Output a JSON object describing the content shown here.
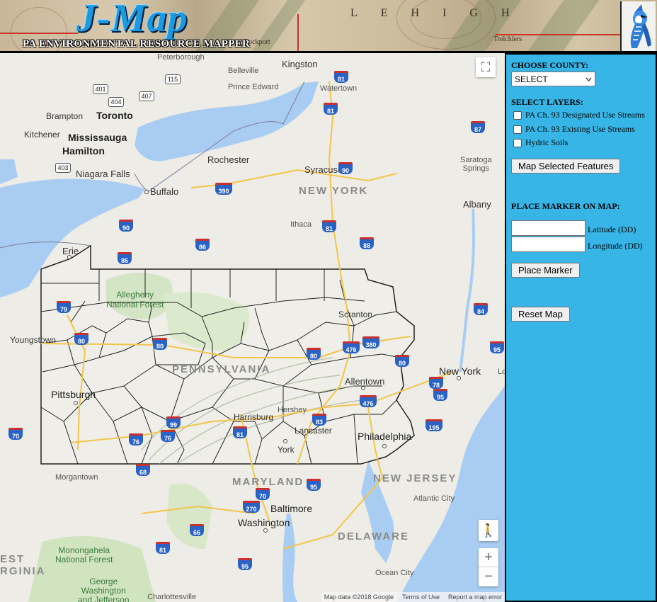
{
  "header": {
    "logo_title": "J-Map",
    "logo_subtitle": "PA ENVIRONMENTAL RESOURCE MAPPER",
    "region_label": "LEHIGH",
    "map_words": [
      "Treichlers",
      "Lockport"
    ]
  },
  "map": {
    "places": {
      "peterborough": "Peterborough",
      "belleville": "Belleville",
      "kingston": "Kingston",
      "prince_edward": "Prince Edward",
      "watertown": "Watertown",
      "brampton": "Brampton",
      "toronto": "Toronto",
      "kitchener": "Kitchener",
      "mississauga": "Mississauga",
      "hamilton": "Hamilton",
      "niagara_falls": "Niagara Falls",
      "buffalo": "Buffalo",
      "rochester": "Rochester",
      "syracuse": "Syracuse",
      "saratoga_springs": "Saratoga\nSprings",
      "albany": "Albany",
      "ithaca": "Ithaca",
      "erie": "Erie",
      "youngstown": "Youngstown",
      "scranton": "Scranton",
      "allentown": "Allentown",
      "new_york": "New York",
      "pittsburgh": "Pittsburgh",
      "hershey": "Hershey",
      "harrisburg": "Harrisburg",
      "lancaster": "Lancaster",
      "york": "York",
      "philadelphia": "Philadelphia",
      "morgantown": "Morgantown",
      "baltimore": "Baltimore",
      "washington": "Washington",
      "atlantic_city": "Atlantic City",
      "ocean_city": "Ocean City",
      "charlottesville": "Charlottesville",
      "george_washington": "George\nWashington\nand Jefferson",
      "lo": "Lo"
    },
    "states": {
      "new_york_state": "NEW YORK",
      "pennsylvania": "PENNSYLVANIA",
      "maryland": "MARYLAND",
      "new_jersey": "NEW JERSEY",
      "delaware": "DELAWARE",
      "west_virginia_a": "EST",
      "west_virginia_b": "RGINIA"
    },
    "parks": {
      "allegheny": "Allegheny\nNational Forest",
      "monongahela": "Monongahela\nNational Forest"
    },
    "highways": [
      "81",
      "81",
      "401",
      "404",
      "407",
      "115",
      "403",
      "87",
      "90",
      "390",
      "81",
      "88",
      "86",
      "86",
      "90",
      "79",
      "80",
      "80",
      "84",
      "380",
      "476",
      "80",
      "95",
      "78",
      "476",
      "95",
      "80",
      "70",
      "99",
      "76",
      "76",
      "81",
      "83",
      "195",
      "68",
      "70",
      "270",
      "95",
      "66",
      "81",
      "95"
    ],
    "controls": {
      "fullscreen_icon": "⛶",
      "pegman_icon": "🚶",
      "zoom_in": "+",
      "zoom_out": "−"
    },
    "attribution": {
      "data": "Map data ©2018 Google",
      "terms": "Terms of Use",
      "report": "Report a map error"
    }
  },
  "panel": {
    "county_heading": "CHOOSE COUNTY:",
    "county_select_value": "SELECT",
    "layers_heading": "SELECT LAYERS:",
    "layers": [
      {
        "label": "PA Ch. 93 Designated Use Streams",
        "checked": false
      },
      {
        "label": "PA Ch. 93 Existing Use Streams",
        "checked": false
      },
      {
        "label": "Hydric Soils",
        "checked": false
      }
    ],
    "map_selected_button": "Map Selected Features",
    "marker_heading": "PLACE MARKER ON MAP:",
    "latitude_label": "Latitude (DD)",
    "longitude_label": "Longitude (DD)",
    "latitude_value": "",
    "longitude_value": "",
    "place_marker_button": "Place Marker",
    "reset_button": "Reset Map"
  },
  "colors": {
    "panel_bg": "#36b5e6",
    "water": "#a9cdf2",
    "interstate": "#2a63c4",
    "logo_blue": "#1a9ae0"
  }
}
